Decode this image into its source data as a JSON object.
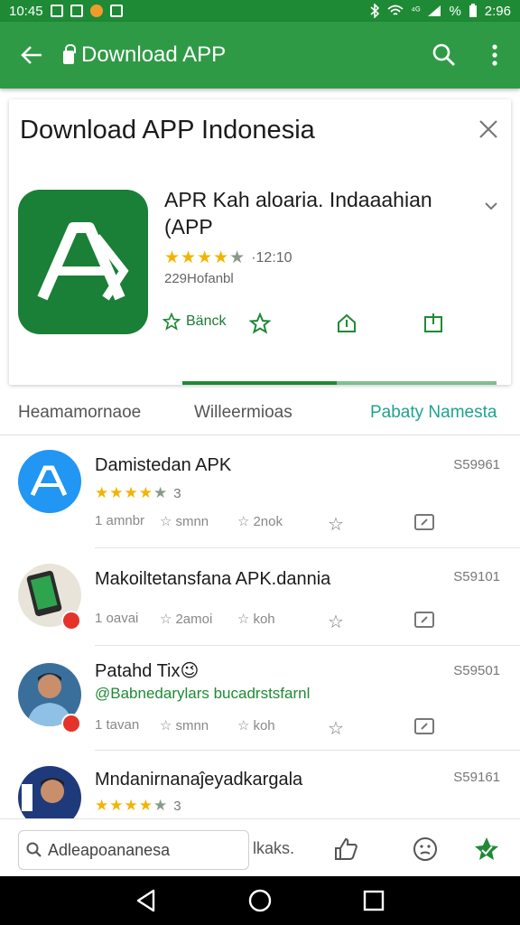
{
  "status_bar": {
    "time": "10:45",
    "right_text": "⁴ᴳ",
    "battery_text": "%",
    "clock_right": "2:96"
  },
  "app_bar": {
    "title": "Download APP"
  },
  "card": {
    "heading": "Download APP Indonesia",
    "app_name": "APR Kah aloaria. Indaaahian (APP",
    "rating_text": "·12:10",
    "meta": "229Hofanbl",
    "action_bank_label": "Bänck",
    "download_progress": 0.49
  },
  "tabs": [
    "Heamamornaoe",
    "Willeermioas",
    "Pabaty Namesta"
  ],
  "list_items": [
    {
      "name": "Damistedan APK",
      "number": "S59961",
      "rating": "3",
      "meta_a": "1 amnbr",
      "meta_b": "smnn",
      "meta_c": "2nok"
    },
    {
      "name": "Makoiltetansfana APK.dannia",
      "number": "S59101",
      "meta_a": "1 oavai",
      "meta_b": "2amoi",
      "meta_c": "koh"
    },
    {
      "name": "Patahd Tix",
      "emoji": "😉",
      "subtitle": "@Babnedarylars bucadrstsfarnl",
      "number": "S59501",
      "meta_a": "1 tavan",
      "meta_b": "smnn",
      "meta_c": "koh"
    },
    {
      "name": "Mndanirnanaĵeyadkargala",
      "number": "S59161",
      "rating": "3"
    }
  ],
  "bottom_bar": {
    "search_placeholder": "Adleapoananesa",
    "label": "lkaks."
  },
  "colors": {
    "primary": "#2f9a45",
    "status": "#1e8a35",
    "star": "#f2b400",
    "accent_teal": "#1fa28f"
  },
  "icons": [
    "back-arrow-icon",
    "lock-icon",
    "search-icon",
    "more-vert-icon",
    "close-icon",
    "chevron-down-icon",
    "star-outline-icon",
    "home-icon",
    "share-icon",
    "feedback-icon",
    "thumb-icon",
    "face-icon",
    "star-badge-icon",
    "nav-back-icon",
    "nav-home-icon",
    "nav-recents-icon"
  ]
}
